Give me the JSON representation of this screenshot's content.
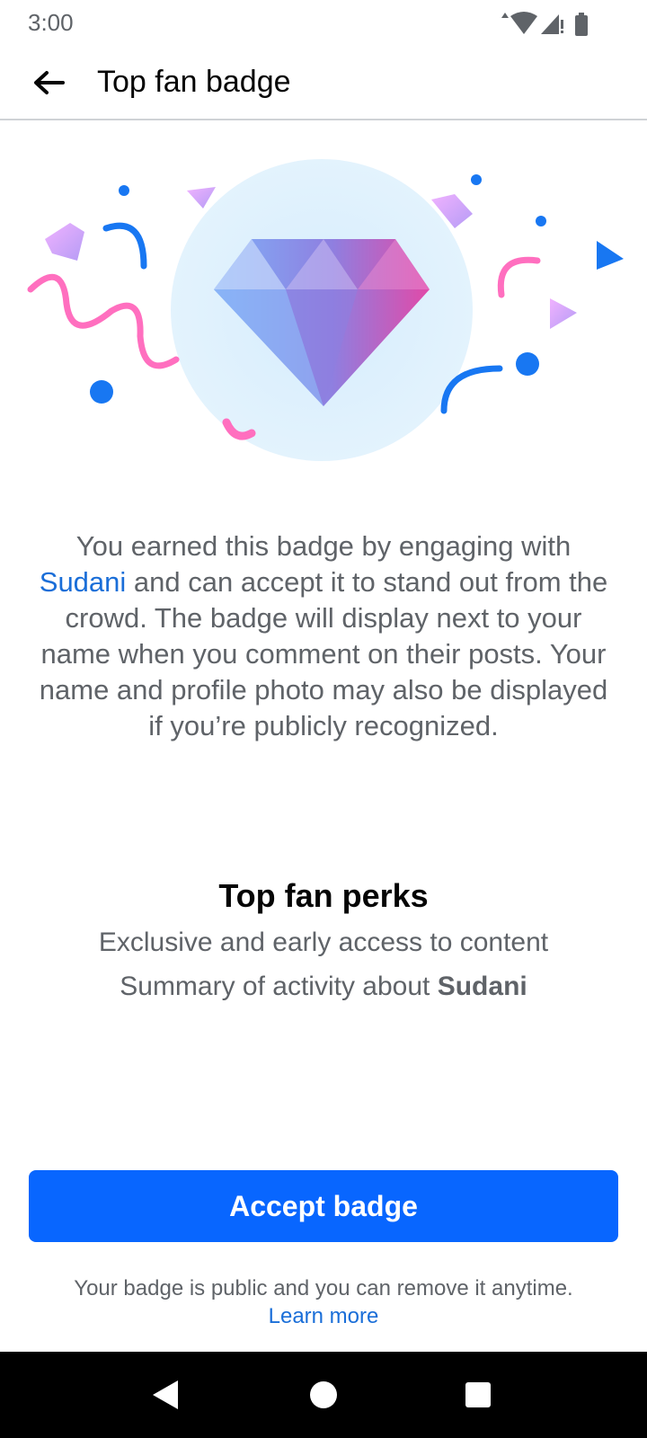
{
  "status_bar": {
    "time": "3:00"
  },
  "header": {
    "title": "Top fan badge",
    "back_icon": "arrow-left-icon"
  },
  "description": {
    "before": "You earned this badge by engaging with ",
    "creator": "Sudani",
    "after": " and can accept it to stand out from the crowd. The badge will display next to your name when you comment on their posts. Your name and profile photo may also be displayed if you’re publicly recognized."
  },
  "perks": {
    "title": "Top fan perks",
    "item1": "Exclusive and early access to content",
    "item2_prefix": "Summary of activity about ",
    "item2_name": "Sudani"
  },
  "actions": {
    "accept_label": "Accept badge"
  },
  "footer": {
    "note": "Your badge is public and you can remove it anytime.",
    "learn_more": "Learn more"
  },
  "colors": {
    "primary": "#0866ff",
    "link": "#1a6ed8",
    "confetti_pink": "#ff6fbf",
    "confetti_blue": "#1877f2"
  },
  "nav": {
    "back": "nav-back-icon",
    "home": "nav-home-icon",
    "recents": "nav-recents-icon"
  }
}
